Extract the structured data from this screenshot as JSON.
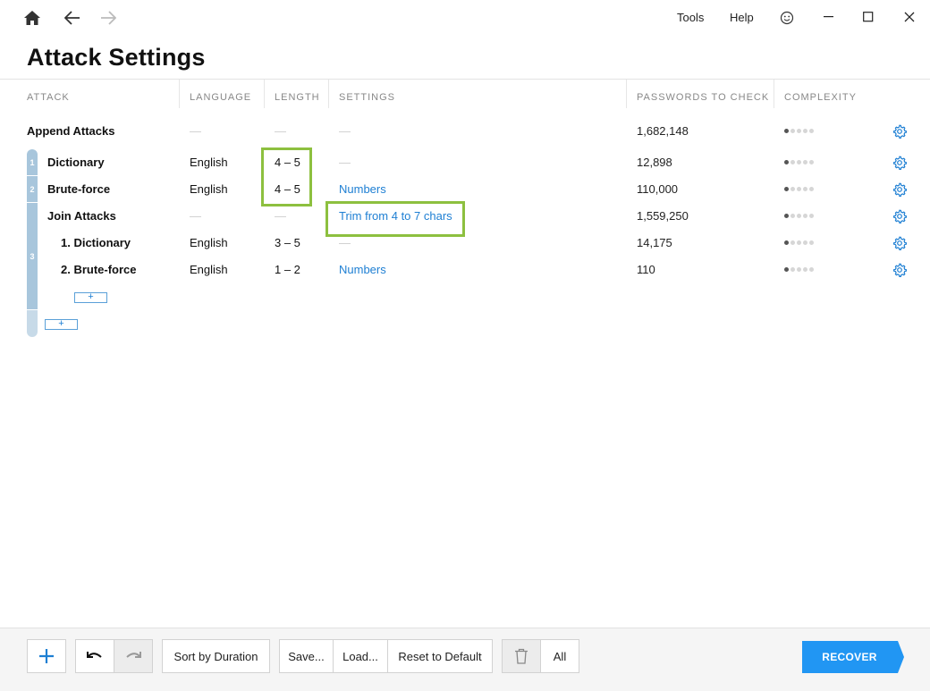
{
  "titlebar": {
    "home_icon": "home-icon",
    "back_icon": "back-arrow-icon",
    "forward_icon": "forward-arrow-icon",
    "menu_tools": "Tools",
    "menu_help": "Help",
    "feedback_icon": "smiley-icon"
  },
  "page": {
    "title": "Attack Settings"
  },
  "columns": {
    "attack": "ATTACK",
    "language": "LANGUAGE",
    "length": "LENGTH",
    "settings": "SETTINGS",
    "passwords": "PASSWORDS TO CHECK",
    "complexity": "COMPLEXITY"
  },
  "rows": [
    {
      "group": "",
      "name": "Append Attacks",
      "language": "—",
      "length": "—",
      "settings": "—",
      "passwords": "1,682,148",
      "complexity": 1
    },
    {
      "group": "1",
      "name": "Dictionary",
      "language": "English",
      "length": "4 – 5",
      "settings": "—",
      "passwords": "12,898",
      "complexity": 1
    },
    {
      "group": "2",
      "name": "Brute-force",
      "language": "English",
      "length": "4 – 5",
      "settings": "Numbers",
      "passwords": "110,000",
      "complexity": 1
    },
    {
      "group": "3",
      "name": "Join Attacks",
      "language": "—",
      "length": "—",
      "settings": "Trim from 4 to 7 chars",
      "passwords": "1,559,250",
      "complexity": 1
    },
    {
      "group": "3",
      "name": "1. Dictionary",
      "language": "English",
      "length": "3 – 5",
      "settings": "—",
      "passwords": "14,175",
      "complexity": 1
    },
    {
      "group": "3",
      "name": "2. Brute-force",
      "language": "English",
      "length": "1 – 2",
      "settings": "Numbers",
      "passwords": "110",
      "complexity": 1
    }
  ],
  "add_labels": {
    "inner": "+",
    "outer": "+"
  },
  "toolbar": {
    "add": "+",
    "sort": "Sort by Duration",
    "save": "Save...",
    "load": "Load...",
    "reset": "Reset to Default",
    "all": "All",
    "recover": "RECOVER"
  },
  "colors": {
    "accent": "#1e7fd3",
    "highlight": "#8dc03f",
    "group_bar": "#a8c6dc",
    "recover": "#2196f3"
  }
}
